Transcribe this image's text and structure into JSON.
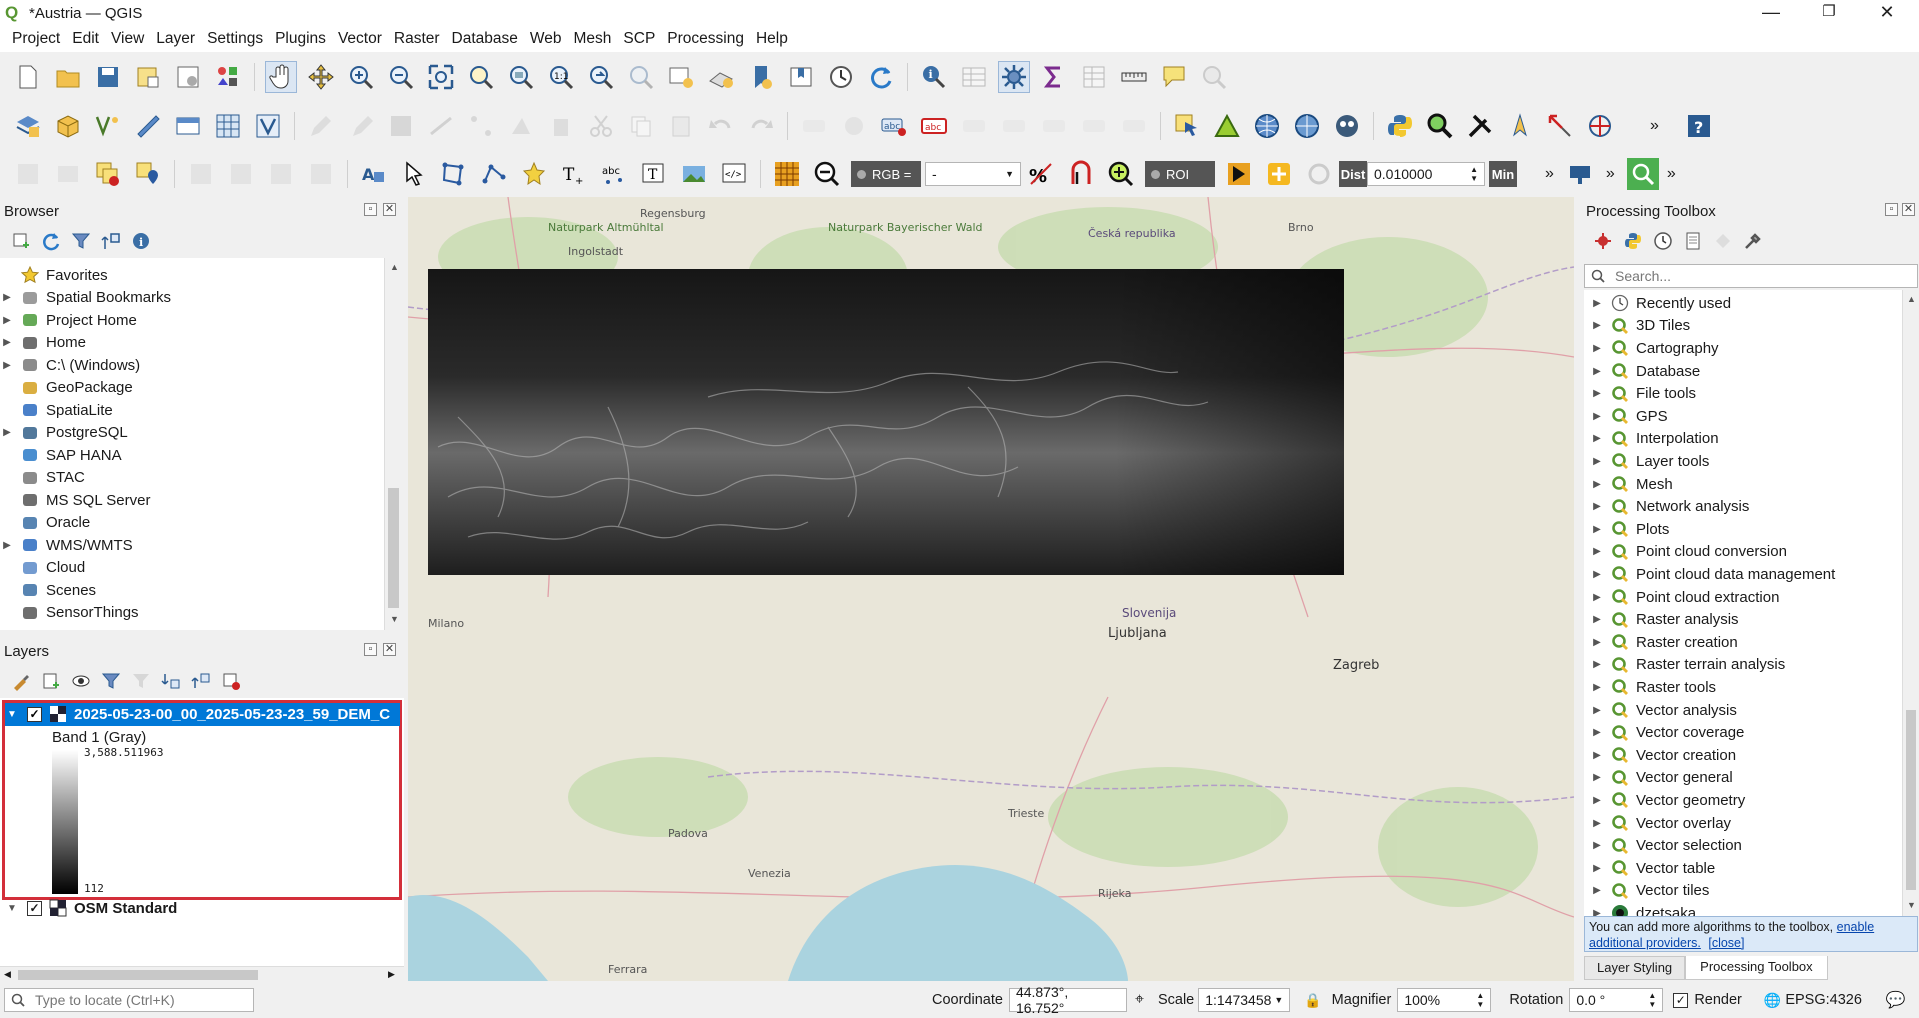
{
  "window": {
    "title": "*Austria — QGIS",
    "app_logo": "Q"
  },
  "menu": [
    "Project",
    "Edit",
    "View",
    "Layer",
    "Settings",
    "Plugins",
    "Vector",
    "Raster",
    "Database",
    "Web",
    "Mesh",
    "SCP",
    "Processing",
    "Help"
  ],
  "toolbar3": {
    "rgb_label": "RGB =",
    "rgb_value": "-",
    "roi_label": "ROI",
    "dist_label": "Dist",
    "dist_value": "0.010000",
    "min_label": "Min"
  },
  "browser": {
    "title": "Browser",
    "items": [
      {
        "label": "Favorites",
        "icon": "star-icon",
        "expand": false
      },
      {
        "label": "Spatial Bookmarks",
        "icon": "bookmarks-icon",
        "expand": true
      },
      {
        "label": "Project Home",
        "icon": "project-home-icon",
        "expand": true
      },
      {
        "label": "Home",
        "icon": "home-icon",
        "expand": true
      },
      {
        "label": "C:\\ (Windows)",
        "icon": "drive-icon",
        "expand": true
      },
      {
        "label": "GeoPackage",
        "icon": "geopackage-icon",
        "expand": false
      },
      {
        "label": "SpatiaLite",
        "icon": "spatialite-icon",
        "expand": false
      },
      {
        "label": "PostgreSQL",
        "icon": "postgresql-icon",
        "expand": true
      },
      {
        "label": "SAP HANA",
        "icon": "saphana-icon",
        "expand": false
      },
      {
        "label": "STAC",
        "icon": "stac-icon",
        "expand": false
      },
      {
        "label": "MS SQL Server",
        "icon": "mssql-icon",
        "expand": false
      },
      {
        "label": "Oracle",
        "icon": "oracle-icon",
        "expand": false
      },
      {
        "label": "WMS/WMTS",
        "icon": "wms-icon",
        "expand": true
      },
      {
        "label": "Cloud",
        "icon": "cloud-icon",
        "expand": false
      },
      {
        "label": "Scenes",
        "icon": "scenes-icon",
        "expand": false
      },
      {
        "label": "SensorThings",
        "icon": "sensorthings-icon",
        "expand": false
      }
    ]
  },
  "layers": {
    "title": "Layers",
    "items": [
      {
        "name": "2025-05-23-00_00_2025-05-23-23_59_DEM_C",
        "checked": true,
        "band": "Band 1 (Gray)",
        "max": "3,588.511963",
        "min": "112"
      },
      {
        "name": "OSM Standard",
        "checked": true
      }
    ]
  },
  "toolbox": {
    "title": "Processing Toolbox",
    "search_placeholder": "Search...",
    "items": [
      "Recently used",
      "3D Tiles",
      "Cartography",
      "Database",
      "File tools",
      "GPS",
      "Interpolation",
      "Layer tools",
      "Mesh",
      "Network analysis",
      "Plots",
      "Point cloud conversion",
      "Point cloud data management",
      "Point cloud extraction",
      "Raster analysis",
      "Raster creation",
      "Raster terrain analysis",
      "Raster tools",
      "Vector analysis",
      "Vector coverage",
      "Vector creation",
      "Vector general",
      "Vector geometry",
      "Vector overlay",
      "Vector selection",
      "Vector table",
      "Vector tiles",
      "dzetsaka"
    ],
    "info_text": "You can add more algorithms to the toolbox,",
    "info_link": "enable additional providers.",
    "info_close": "[close]",
    "tabs": [
      "Layer Styling",
      "Processing Toolbox"
    ]
  },
  "map_labels": {
    "cities": [
      "Regensburg",
      "Brno",
      "Ingolstadt",
      "Ljubljana",
      "Zagreb",
      "Venezia",
      "Trieste",
      "Rijeka",
      "Slovenija",
      "Padova",
      "Ferrara",
      "Milano"
    ],
    "parks": [
      "Naturpark Altmühltal",
      "Naturpark Bayerischer Wald",
      "Česká republika"
    ]
  },
  "statusbar": {
    "locate_placeholder": "Type to locate (Ctrl+K)",
    "coordinate_label": "Coordinate",
    "coordinate_value": "44.873°, 16.752°",
    "scale_label": "Scale",
    "scale_value": "1:1473458",
    "magnifier_label": "Magnifier",
    "magnifier_value": "100%",
    "rotation_label": "Rotation",
    "rotation_value": "0.0 °",
    "render_label": "Render",
    "crs": "EPSG:4326"
  },
  "colors": {
    "accent": "#0078d7",
    "highlight_border": "#d32f3a",
    "qgis_green": "#589632",
    "info_bg": "#dbe9f8"
  }
}
